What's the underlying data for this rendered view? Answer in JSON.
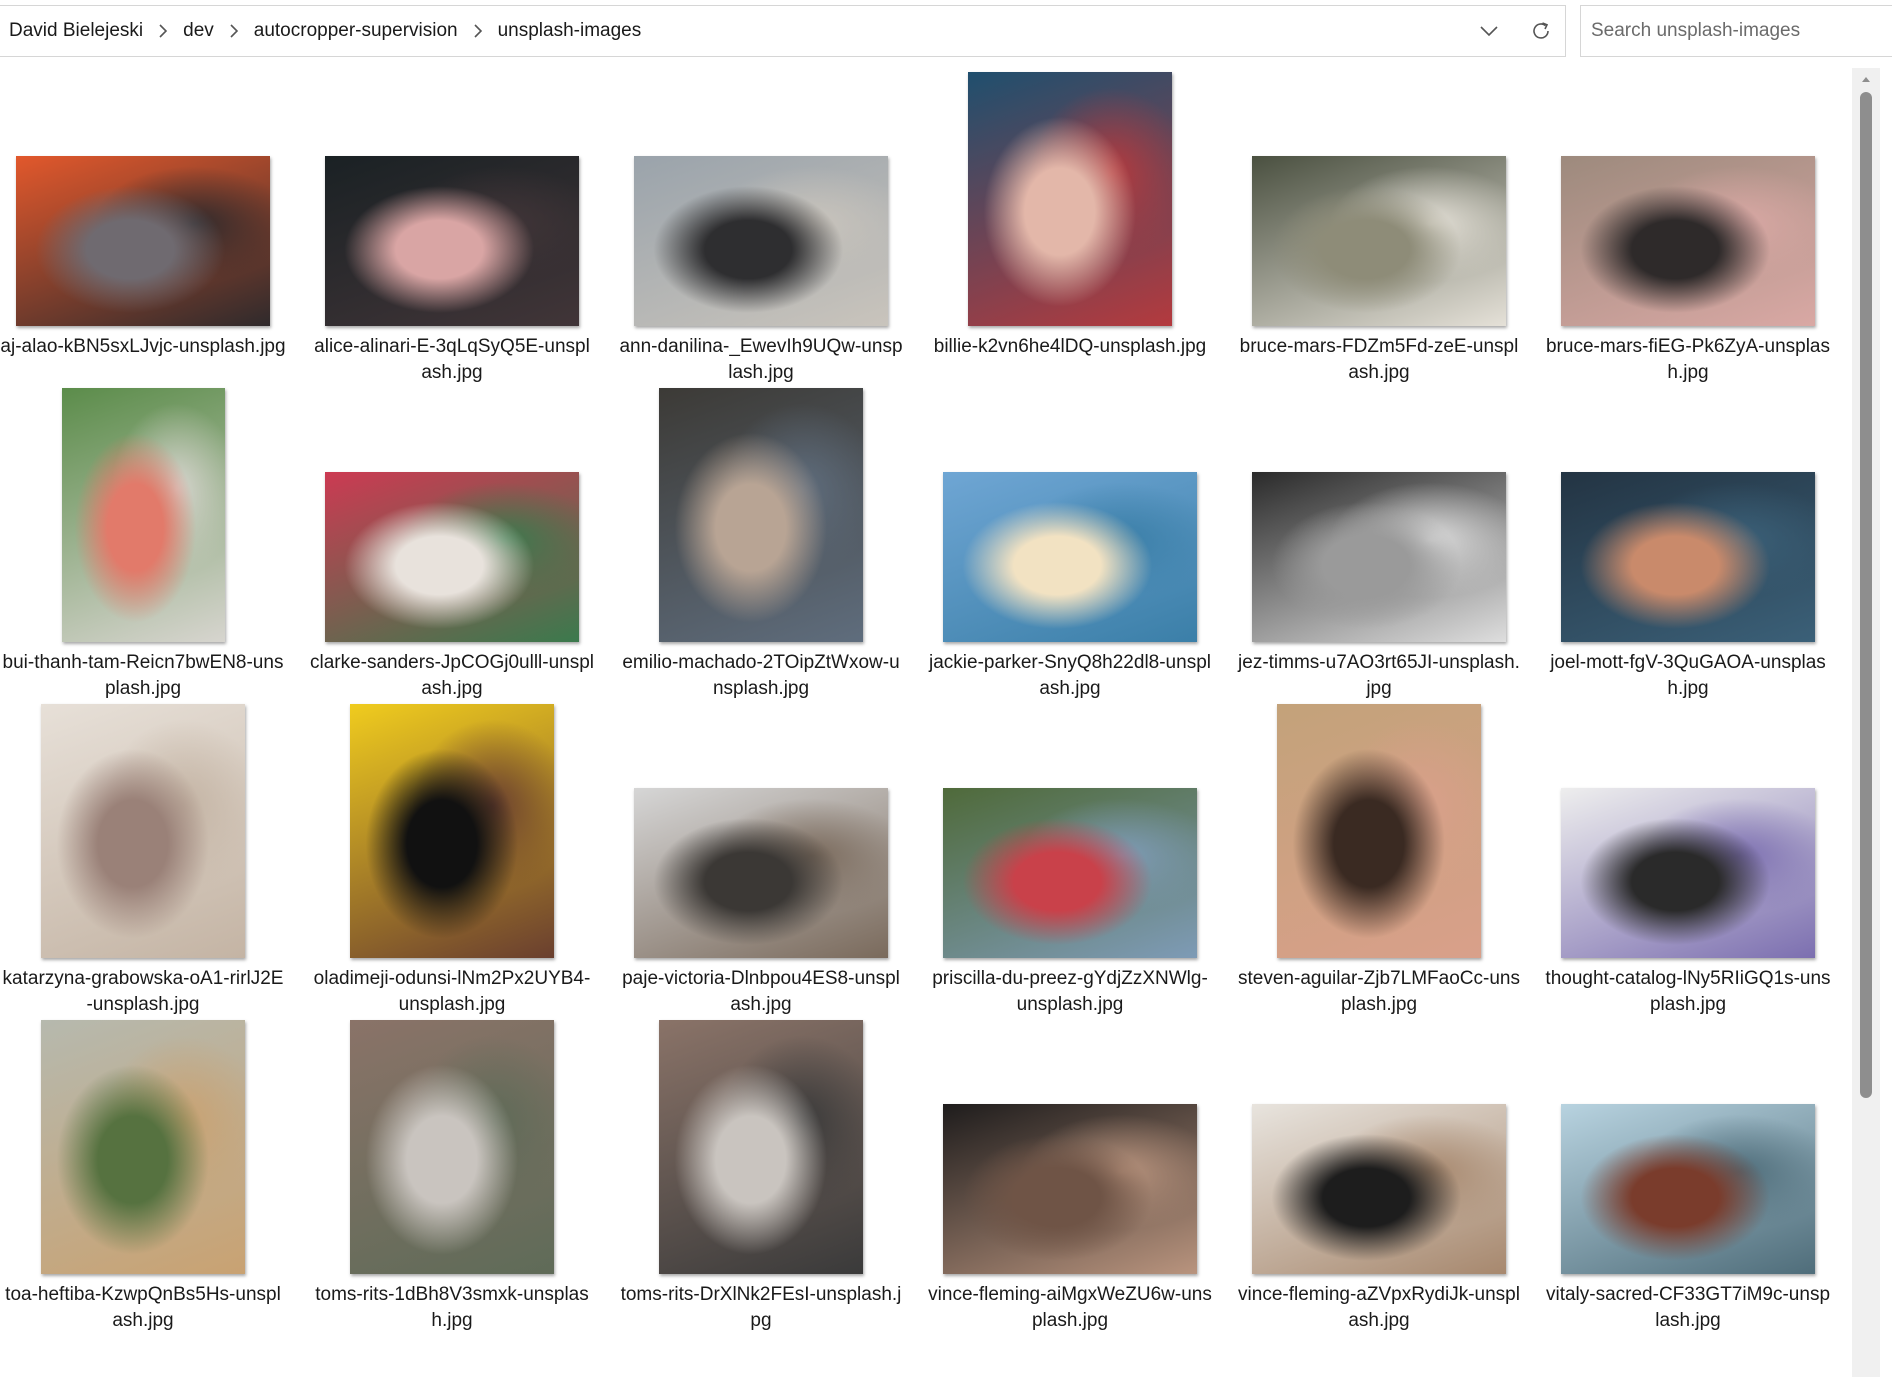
{
  "breadcrumb": {
    "items": [
      "David Bielejeski",
      "dev",
      "autocropper-supervision",
      "unsplash-images"
    ]
  },
  "toolbar": {
    "dropdown_icon": "chevron-down-icon",
    "refresh_icon": "refresh-icon"
  },
  "search": {
    "placeholder": "Search unsplash-images",
    "value": ""
  },
  "files": [
    {
      "name": "aj-alao-kBN5sxLJvjc-unsplash.jpg",
      "orientation": "landscape",
      "colors": [
        "#e2582c",
        "#6f6a70",
        "#2f2a2c"
      ]
    },
    {
      "name": "alice-alinari-E-3qLqSyQ5E-unsplash.jpg",
      "orientation": "landscape",
      "colors": [
        "#1a2124",
        "#d9a5a4",
        "#413538"
      ]
    },
    {
      "name": "ann-danilina-_EwevIh9UQw-unsplash.jpg",
      "orientation": "landscape",
      "colors": [
        "#9aa3ab",
        "#2e2e30",
        "#c9c4bc"
      ]
    },
    {
      "name": "billie-k2vn6he4lDQ-unsplash.jpg",
      "orientation": "portrait",
      "colors": [
        "#1f4f6e",
        "#e3b7a9",
        "#b43a3e"
      ]
    },
    {
      "name": "bruce-mars-FDZm5Fd-zeE-unsplash.jpg",
      "orientation": "landscape",
      "colors": [
        "#4a5040",
        "#8e8c78",
        "#e5e1d8"
      ]
    },
    {
      "name": "bruce-mars-fiEG-Pk6ZyA-unsplash.jpg",
      "orientation": "landscape",
      "colors": [
        "#9d8a7d",
        "#2e2a2a",
        "#d9a8a4"
      ]
    },
    {
      "name": "bui-thanh-tam-Reicn7bwEN8-unsplash.jpg",
      "orientation": "portrait-narrow",
      "colors": [
        "#5b8c4a",
        "#e27a6a",
        "#d7d5cf"
      ]
    },
    {
      "name": "clarke-sanders-JpCOGj0ulll-unsplash.jpg",
      "orientation": "landscape",
      "colors": [
        "#cc3a52",
        "#e8e2dc",
        "#3b7a4d"
      ]
    },
    {
      "name": "emilio-machado-2TOipZtWxow-unsplash.jpg",
      "orientation": "portrait",
      "colors": [
        "#3c3a36",
        "#b8a494",
        "#5f6d7d"
      ]
    },
    {
      "name": "jackie-parker-SnyQ8h22dl8-unsplash.jpg",
      "orientation": "landscape",
      "colors": [
        "#6fa6d4",
        "#f2e2c2",
        "#3b7fa8"
      ]
    },
    {
      "name": "jez-timms-u7AO3rt65JI-unsplash.jpg",
      "orientation": "landscape",
      "colors": [
        "#2a2a2a",
        "#9a9a9a",
        "#dedede"
      ]
    },
    {
      "name": "joel-mott-fgV-3QuGAOA-unsplash.jpg",
      "orientation": "landscape",
      "colors": [
        "#233443",
        "#c98a6b",
        "#3b6078"
      ]
    },
    {
      "name": "katarzyna-grabowska-oA1-rirlJ2E-unsplash.jpg",
      "orientation": "portrait",
      "colors": [
        "#e7e0d8",
        "#9a8178",
        "#c4b4a4"
      ]
    },
    {
      "name": "oladimeji-odunsi-lNm2Px2UYB4-unsplash.jpg",
      "orientation": "portrait",
      "colors": [
        "#f0cc1e",
        "#111111",
        "#6a3f2f"
      ]
    },
    {
      "name": "paje-victoria-Dlnbpou4ES8-unsplash.jpg",
      "orientation": "landscape",
      "colors": [
        "#d6d6d6",
        "#3b3835",
        "#7a6a5c"
      ]
    },
    {
      "name": "priscilla-du-preez-gYdjZzXNWlg-unsplash.jpg",
      "orientation": "landscape",
      "colors": [
        "#4f6a3a",
        "#c9414a",
        "#7e9bb6"
      ]
    },
    {
      "name": "steven-aguilar-Zjb7LMFaoCc-unsplash.jpg",
      "orientation": "portrait",
      "colors": [
        "#c3a27a",
        "#3a2a22",
        "#d9a08a"
      ]
    },
    {
      "name": "thought-catalog-lNy5RIiGQ1s-unsplash.jpg",
      "orientation": "landscape",
      "colors": [
        "#eeeeee",
        "#2a2a2a",
        "#7c6fb0"
      ]
    },
    {
      "name": "toa-heftiba-KzwpQnBs5Hs-unsplash.jpg",
      "orientation": "portrait",
      "colors": [
        "#b6b9ae",
        "#567240",
        "#c9a272"
      ]
    },
    {
      "name": "toms-rits-1dBh8V3smxk-unsplash.jpg",
      "orientation": "portrait",
      "colors": [
        "#8a7368",
        "#c9c4bf",
        "#5f6b58"
      ]
    },
    {
      "name": "toms-rits-DrXlNk2FEsI-unsplash.jpg",
      "orientation": "portrait",
      "colors": [
        "#8a7368",
        "#c9c4bf",
        "#3a3a3a"
      ]
    },
    {
      "name": "vince-fleming-aiMgxWeZU6w-unsplash.jpg",
      "orientation": "landscape",
      "colors": [
        "#1e1c1c",
        "#6f5446",
        "#b9947e"
      ]
    },
    {
      "name": "vince-fleming-aZVpxRydiJk-unsplash.jpg",
      "orientation": "landscape",
      "colors": [
        "#e8e4de",
        "#1d1d1d",
        "#a7886e"
      ]
    },
    {
      "name": "vitaly-sacred-CF33GT7iM9c-unsplash.jpg",
      "orientation": "landscape",
      "colors": [
        "#b8d3e0",
        "#7a3c2c",
        "#4f6d7a"
      ]
    }
  ],
  "scrollbar": {
    "position_fraction": 0.0
  }
}
